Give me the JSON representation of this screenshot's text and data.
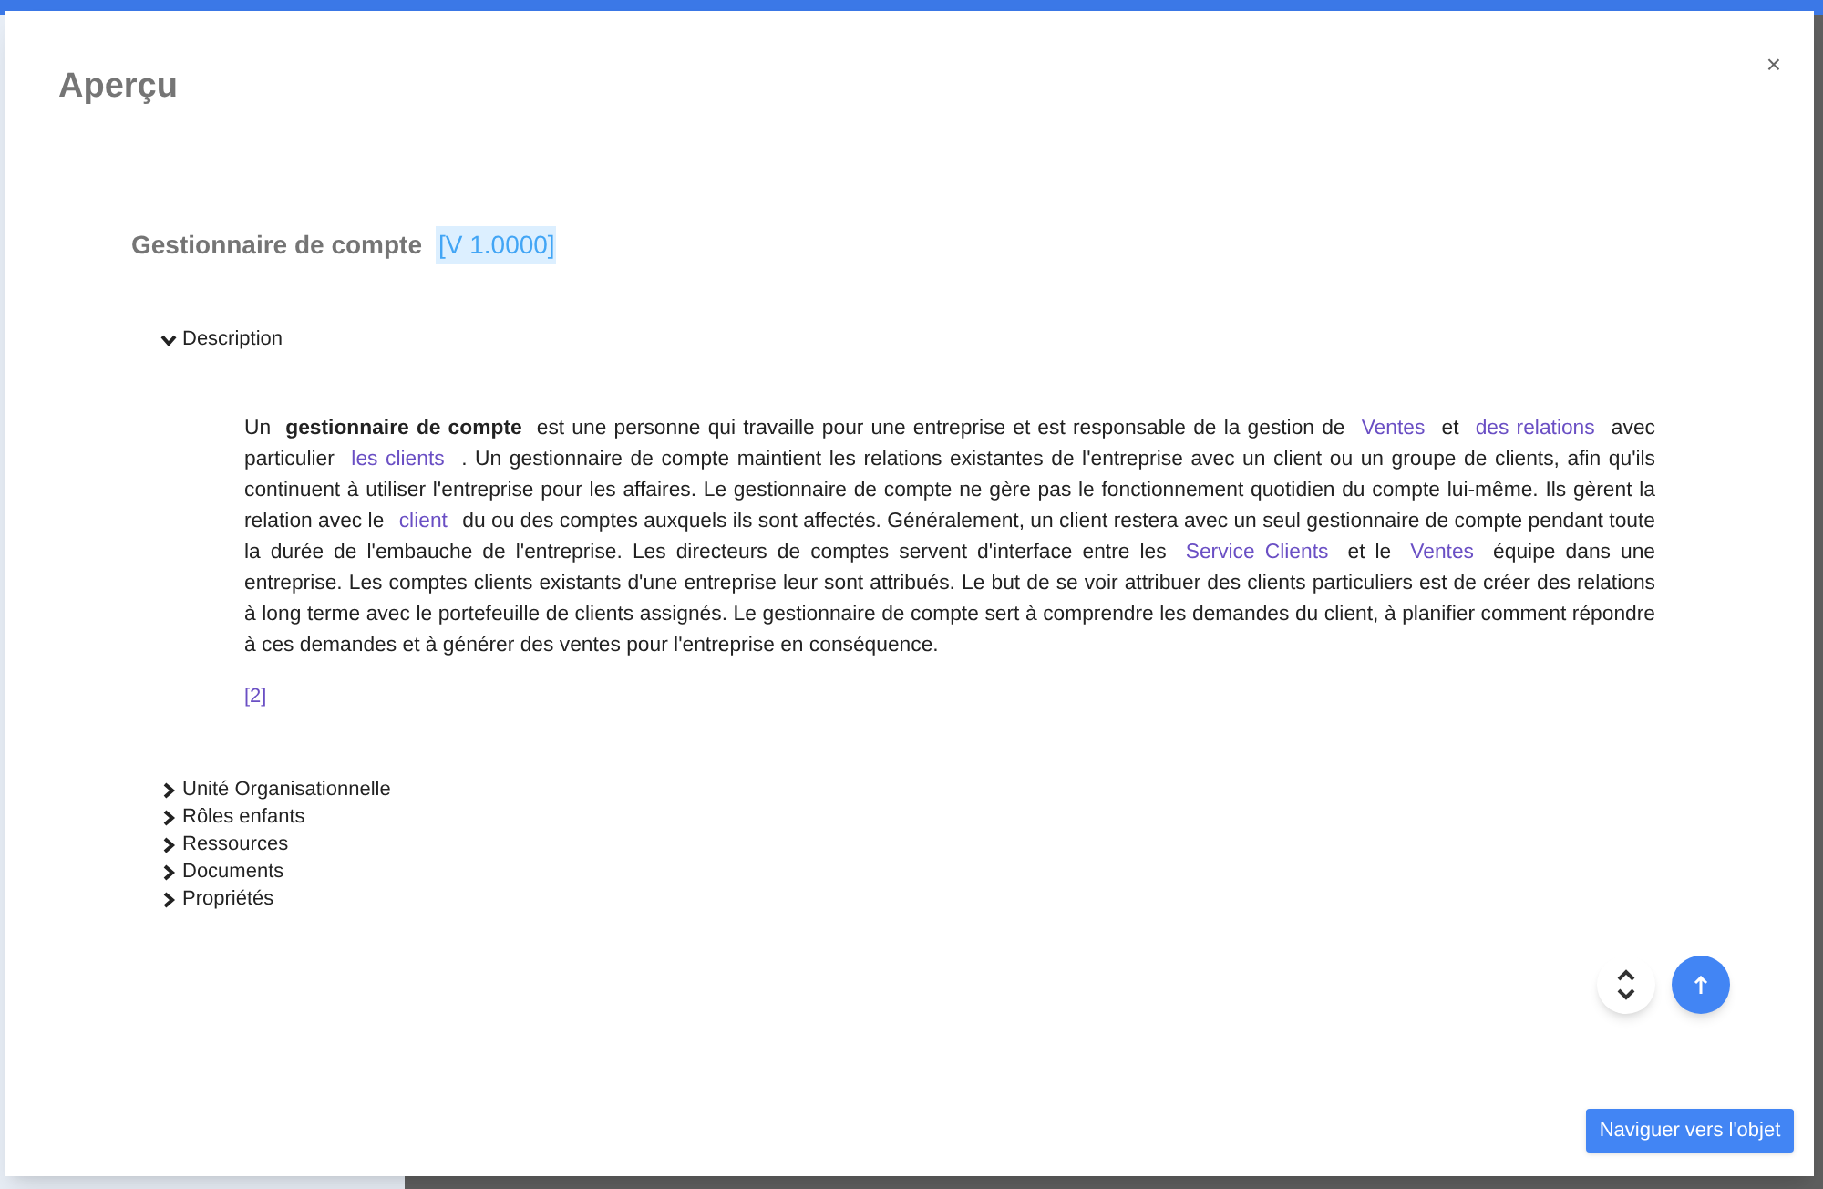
{
  "dialog": {
    "title": "Aperçu",
    "close": "×"
  },
  "object": {
    "name": "Gestionnaire de compte",
    "version": "[V 1.0000]"
  },
  "sections": [
    {
      "label": "Description",
      "expanded": true,
      "paragraph": [
        {
          "kind": "text",
          "text": "Un "
        },
        {
          "kind": "bold",
          "text": "gestionnaire de compte"
        },
        {
          "kind": "text",
          "text": " est une personne qui travaille pour une entreprise et est responsable de la gestion de "
        },
        {
          "kind": "link",
          "text": "Ventes"
        },
        {
          "kind": "text",
          "text": " et "
        },
        {
          "kind": "link",
          "text": "des relations"
        },
        {
          "kind": "text",
          "text": " avec particulier "
        },
        {
          "kind": "link",
          "text": "les clients"
        },
        {
          "kind": "text",
          "text": " . Un gestionnaire de compte maintient les relations existantes de l'entreprise avec un client ou un groupe de clients, afin qu'ils continuent à utiliser l'entreprise pour les affaires. Le gestionnaire de compte ne gère pas le fonctionnement quotidien du compte lui-même. Ils gèrent la relation avec le "
        },
        {
          "kind": "link",
          "text": "client"
        },
        {
          "kind": "text",
          "text": " du ou des comptes auxquels ils sont affectés. Généralement, un client restera avec un seul gestionnaire de compte pendant toute la durée de l'embauche de l'entreprise. Les directeurs de comptes servent d'interface entre les "
        },
        {
          "kind": "link",
          "text": "Service Clients"
        },
        {
          "kind": "text",
          "text": " et le "
        },
        {
          "kind": "link",
          "text": "Ventes"
        },
        {
          "kind": "text",
          "text": " équipe dans une entreprise. Les comptes clients existants d'une entreprise leur sont attribués. Le but de se voir attribuer des clients particuliers est de créer des relations à long terme avec le portefeuille de clients assignés. Le gestionnaire de compte sert à comprendre les demandes du client, à planifier comment répondre à ces demandes et à générer des ventes pour l'entreprise en conséquence."
        }
      ],
      "reference": "[2]"
    },
    {
      "label": "Unité Organisationnelle",
      "expanded": false
    },
    {
      "label": "Rôles enfants",
      "expanded": false
    },
    {
      "label": "Ressources",
      "expanded": false
    },
    {
      "label": "Documents",
      "expanded": false
    },
    {
      "label": "Propriétés",
      "expanded": false
    }
  ],
  "footer_button": "Naviguer vers l'objet"
}
